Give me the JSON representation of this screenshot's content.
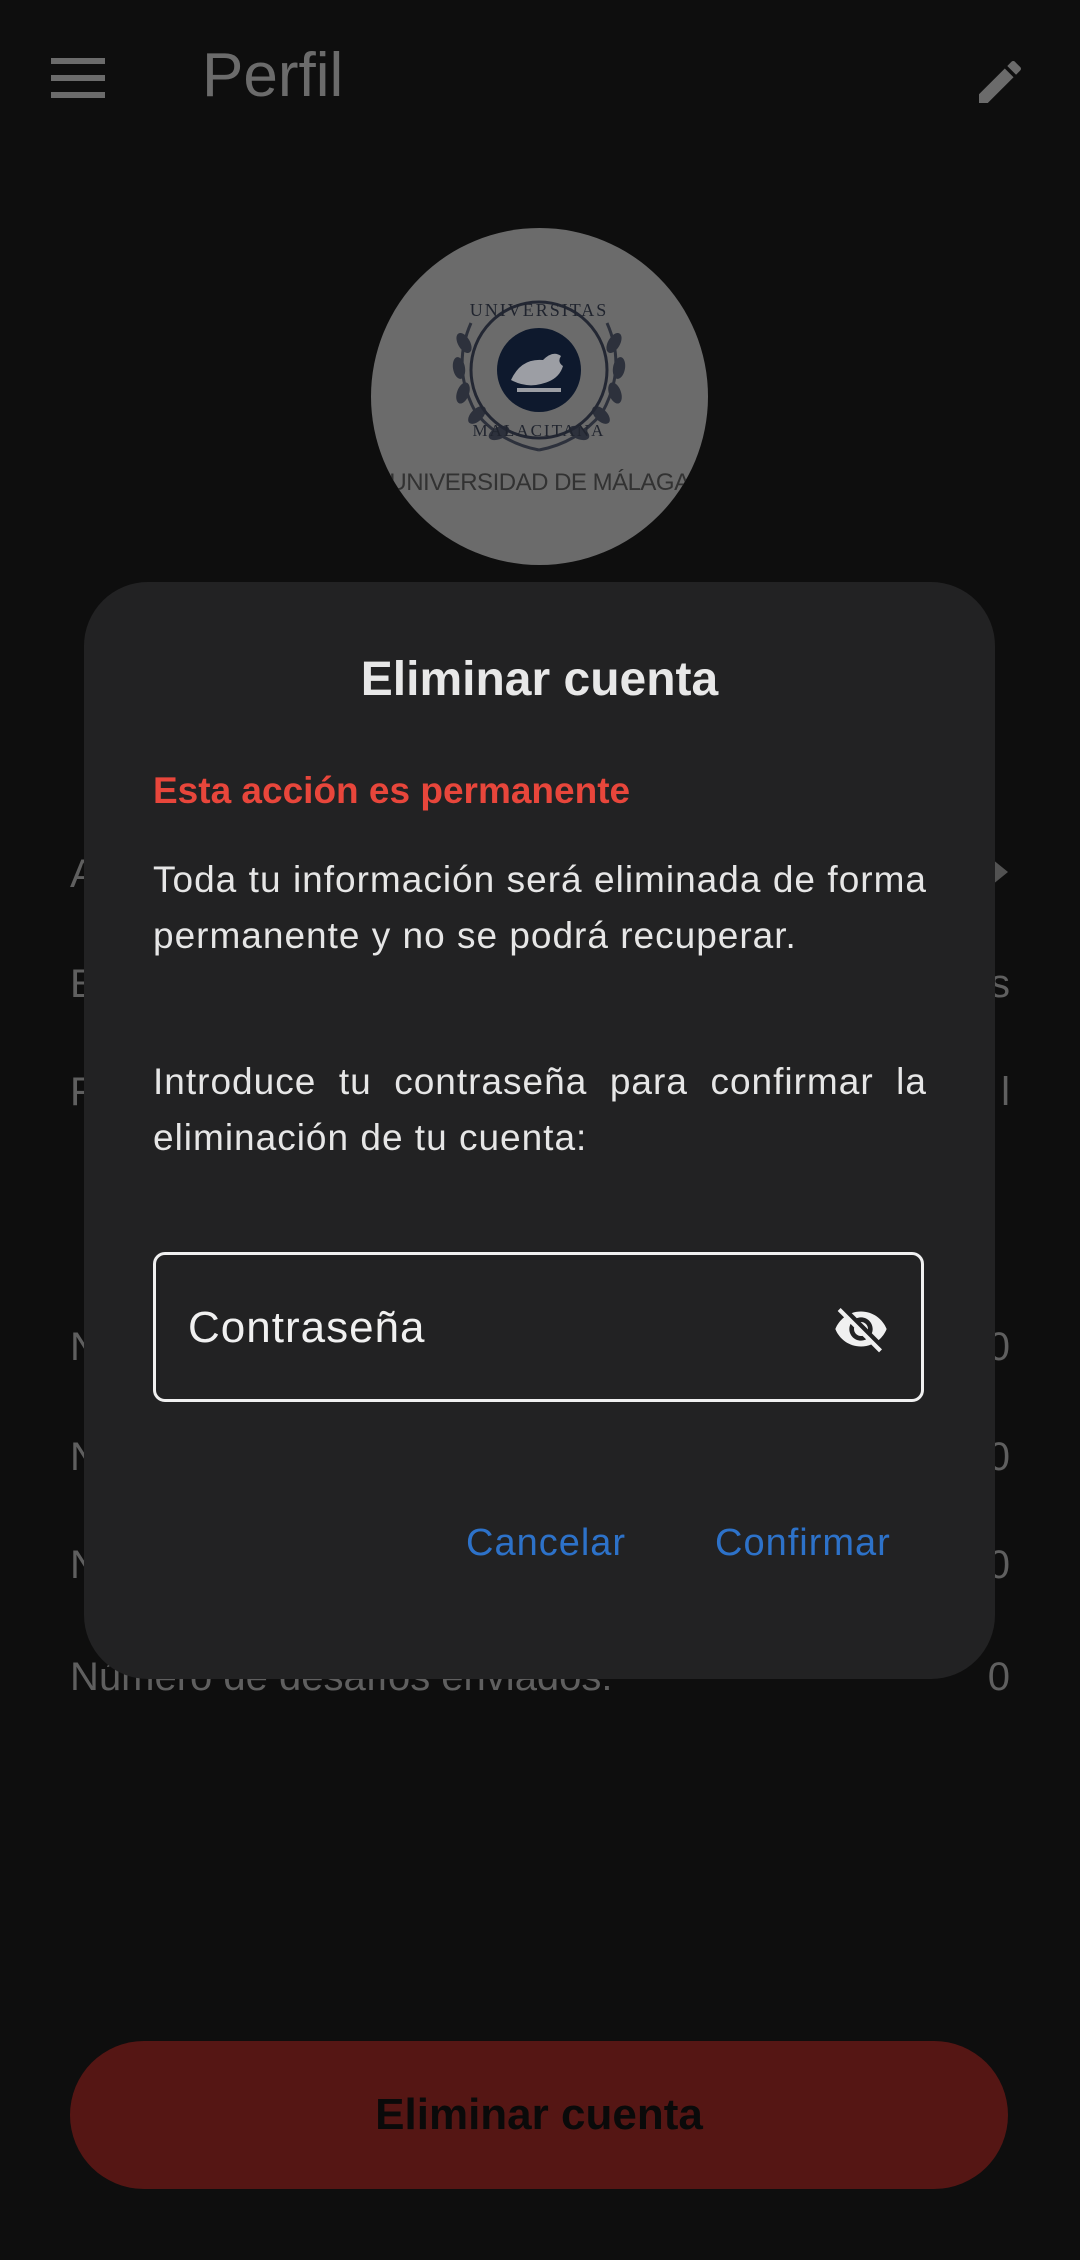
{
  "app_bar": {
    "title": "Perfil",
    "menu_icon": "menu-icon",
    "edit_icon": "edit-pencil-icon"
  },
  "avatar": {
    "logo_text": "UNIVERSITAS MALACITANA",
    "caption": "UNIVERSIDAD DE MÁLAGA"
  },
  "background_rows": [
    {
      "label": "A",
      "value": ""
    },
    {
      "label": "E",
      "value": "s"
    },
    {
      "label": "F",
      "value": "l"
    },
    {
      "label": "N",
      "value": "0"
    },
    {
      "label": "N",
      "value": "0"
    },
    {
      "label": "N",
      "value": "0"
    },
    {
      "label": "Número de desafíos enviados:",
      "value": "0"
    }
  ],
  "delete_button": {
    "label": "Eliminar cuenta",
    "color": "#6e1d1a"
  },
  "dialog": {
    "title": "Eliminar cuenta",
    "warning": "Esta acción es permanente",
    "warning_color": "#e8463b",
    "paragraph1": "Toda tu información será eliminada de forma permanente y no se podrá recuperar.",
    "paragraph2": "Introduce tu contraseña para confirmar la eliminación de tu cuenta:",
    "password_field": {
      "placeholder": "Contraseña",
      "value": "",
      "icon": "visibility-off-icon"
    },
    "cancel_label": "Cancelar",
    "confirm_label": "Confirmar",
    "action_color": "#2d72c9"
  }
}
